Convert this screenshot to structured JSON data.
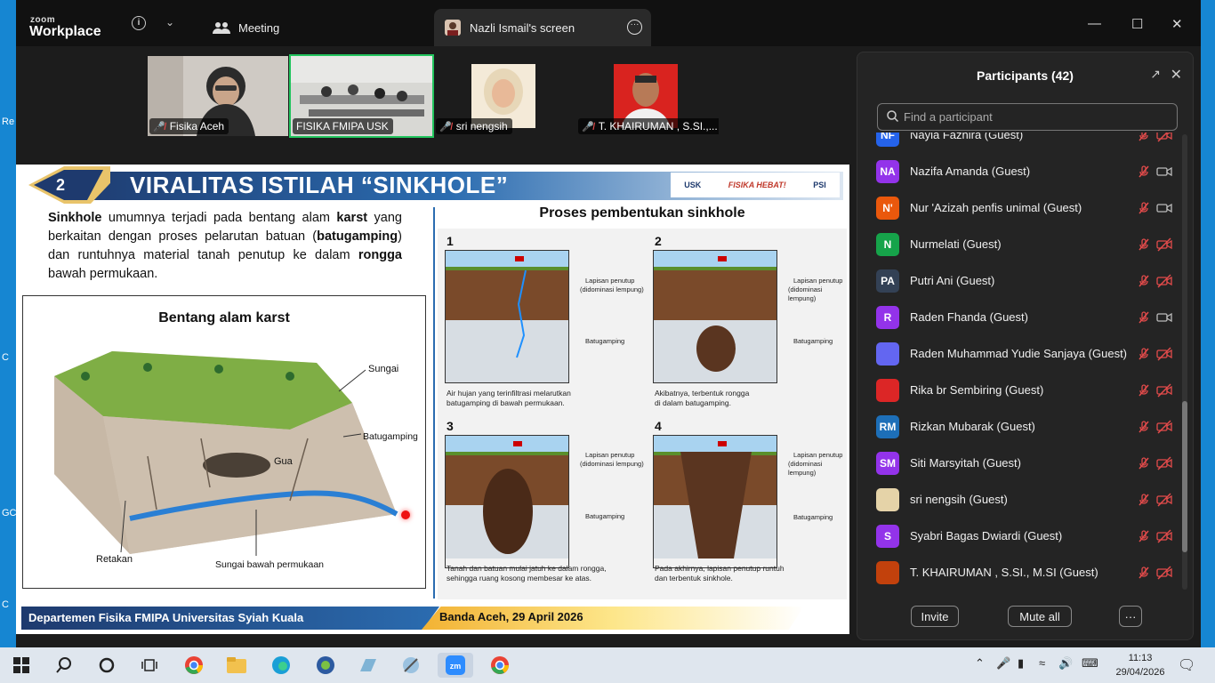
{
  "app": {
    "logo_top": "zoom",
    "logo_main": "Workplace"
  },
  "tabs": [
    {
      "label": "Meeting"
    },
    {
      "label": "Nazli Ismail's screen"
    }
  ],
  "videos": [
    {
      "name": "Fisika Aceh"
    },
    {
      "name": "FISIKA FMIPA USK"
    },
    {
      "name": "sri nengsih"
    },
    {
      "name": "T. KHAIRUMAN , S.SI.,..."
    }
  ],
  "slide": {
    "number": "2",
    "title": "VIRALITAS ISTILAH “SINKHOLE”",
    "logos": [
      "USK",
      "FISIKA HEBAT!",
      "PSI"
    ],
    "paragraph": {
      "p1": "Sinkhole",
      "p2": " umumnya terjadi pada bentang alam ",
      "p3": "karst",
      "p4": " yang berkaitan dengan proses pelarutan batuan (",
      "p5": "batugamping",
      "p6": ") dan runtuhnya material tanah penutup ke dalam ",
      "p7": "rongga",
      "p8": " bawah permukaan."
    },
    "karst": {
      "title": "Bentang alam karst",
      "labels": {
        "sungai": "Sungai",
        "batugamping": "Batugamping",
        "gua": "Gua",
        "retakan": "Retakan",
        "sungai_bawah": "Sungai bawah permukaan"
      }
    },
    "process": {
      "title": "Proses pembentukan sinkhole",
      "label_cover": "Lapisan penutup",
      "label_cover2": "(didominasi lempung)",
      "label_rock": "Batugamping",
      "steps": [
        {
          "num": "1",
          "cap1": "Air hujan yang terinfiltrasi melarutkan",
          "cap2": "batugamping di bawah permukaan."
        },
        {
          "num": "2",
          "cap1": "Akibatnya, terbentuk rongga",
          "cap2": "di dalam batugamping."
        },
        {
          "num": "3",
          "cap1": "Tanah dan batuan mulai jatuh ke dalam rongga,",
          "cap2": "sehingga ruang kosong membesar ke atas."
        },
        {
          "num": "4",
          "cap1": "Pada akhirnya, lapisan penutup runtuh",
          "cap2": "dan terbentuk sinkhole."
        }
      ]
    },
    "footer_left": "Departemen Fisika FMIPA Universitas Syiah Kuala",
    "footer_right": "Banda Aceh, 29 April 2026"
  },
  "participants": {
    "title": "Participants (42)",
    "search_placeholder": "Find a participant",
    "list": [
      {
        "initials": "NF",
        "name": "Nayla Fazhira (Guest)",
        "color": "#2563eb",
        "cam": "off"
      },
      {
        "initials": "NA",
        "name": "Nazifa Amanda (Guest)",
        "color": "#9333ea",
        "cam": "on"
      },
      {
        "initials": "N'",
        "name": "Nur 'Azizah penfis unimal (Guest)",
        "color": "#ea580c",
        "cam": "on"
      },
      {
        "initials": "N",
        "name": "Nurmelati (Guest)",
        "color": "#16a34a",
        "cam": "off"
      },
      {
        "initials": "PA",
        "name": "Putri Ani (Guest)",
        "color": "#334155",
        "cam": "off"
      },
      {
        "initials": "R",
        "name": "Raden Fhanda (Guest)",
        "color": "#9333ea",
        "cam": "on"
      },
      {
        "initials": "",
        "name": "Raden Muhammad Yudie Sanjaya (Guest)",
        "color": "#6366f1",
        "cam": "off"
      },
      {
        "initials": "",
        "name": "Rika br Sembiring (Guest)",
        "color": "#dc2626",
        "cam": "off"
      },
      {
        "initials": "RM",
        "name": "Rizkan Mubarak (Guest)",
        "color": "#1d6fb8",
        "cam": "off"
      },
      {
        "initials": "SM",
        "name": "Siti Marsyitah (Guest)",
        "color": "#9333ea",
        "cam": "off"
      },
      {
        "initials": "",
        "name": "sri nengsih (Guest)",
        "color": "#e5d3a8",
        "cam": "off"
      },
      {
        "initials": "S",
        "name": "Syabri Bagas Dwiardi (Guest)",
        "color": "#9333ea",
        "cam": "off"
      },
      {
        "initials": "",
        "name": "T. KHAIRUMAN , S.SI., M.SI (Guest)",
        "color": "#c2410c",
        "cam": "off"
      }
    ],
    "buttons": {
      "invite": "Invite",
      "mute_all": "Mute all",
      "more": "···"
    }
  },
  "taskbar": {
    "time": "11:13",
    "date": "29/04/2026"
  },
  "desktop_edge_letters": [
    "Re",
    "C",
    "GC",
    "C"
  ]
}
